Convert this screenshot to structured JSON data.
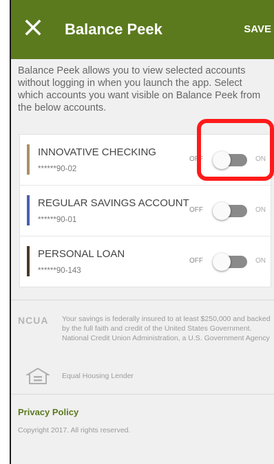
{
  "header": {
    "title": "Balance Peek",
    "save_label": "SAVE",
    "close_icon": "close-icon"
  },
  "intro": "Balance Peek allows you to view selected accounts without logging in when you launch the app. Select which accounts you want visible on Balance Peek from the below accounts.",
  "accounts": [
    {
      "name": "INNOVATIVE CHECKING",
      "number": "******90-02",
      "color": "#a89065",
      "enabled": false
    },
    {
      "name": "REGULAR SAVINGS ACCOUNT",
      "number": "******90-01",
      "color": "#4a5fae",
      "enabled": false
    },
    {
      "name": "PERSONAL LOAN",
      "number": "******90-143",
      "color": "#4a3a2a",
      "enabled": false
    }
  ],
  "toggle": {
    "off_label": "OFF",
    "on_label": "ON"
  },
  "footer": {
    "ncua_logo": "NCUA",
    "ncua_text": "Your savings is federally insured to at least $250,000 and backed by the full faith and credit of the United States Government. National Credit Union Administration, a U.S. Government Agency",
    "equal_housing": "Equal Housing Lender",
    "privacy_policy": "Privacy Policy",
    "copyright": "Copyright 2017. All rights reserved."
  },
  "colors": {
    "header_bg": "#5b7a1e",
    "highlight": "#ff1a1a"
  }
}
